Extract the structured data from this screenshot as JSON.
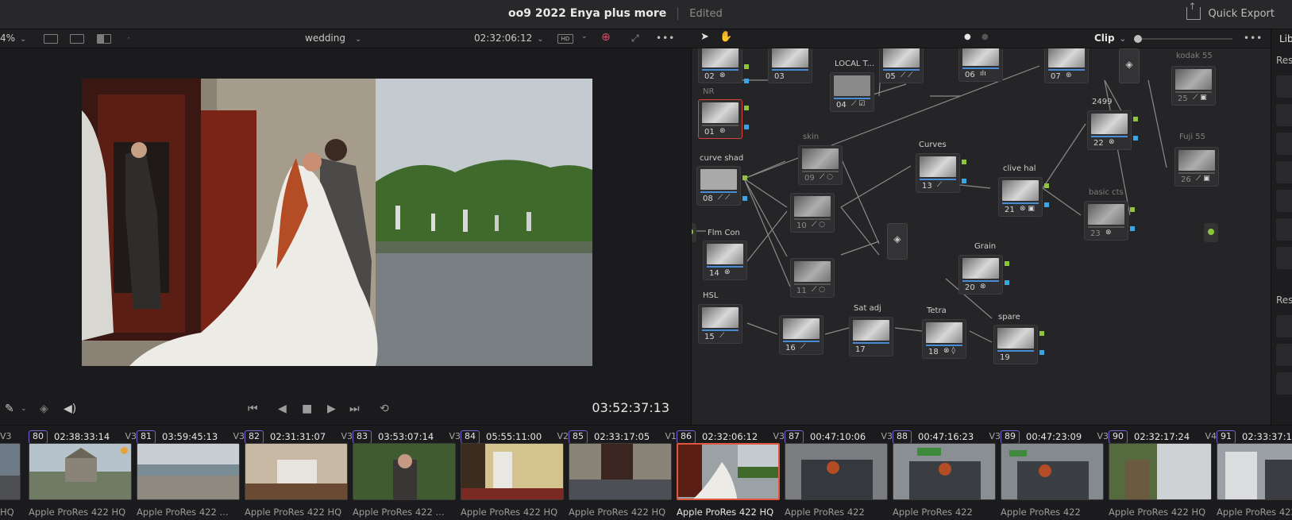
{
  "title_bar": {
    "project": "oo9 2022  Enya plus more",
    "status": "Edited",
    "quick_export": "Quick Export"
  },
  "viewer_toolbar": {
    "zoom": "4%",
    "timeline": "wedding",
    "timecode": "02:32:06:12"
  },
  "transport": {
    "timecode": "03:52:37:13"
  },
  "node_toolbar": {
    "mode": "Clip"
  },
  "library_panel": {
    "tab": "Lib",
    "section1": "Res",
    "section2": "Res"
  },
  "nodes": [
    {
      "id": "01",
      "label": "NR",
      "icons": "⊛"
    },
    {
      "id": "02",
      "label": "",
      "icons": "⊗"
    },
    {
      "id": "03",
      "label": "",
      "icons": ""
    },
    {
      "id": "04",
      "label": "LOCAL T...",
      "icons": "⟋ ☑"
    },
    {
      "id": "05",
      "label": "",
      "icons": "⟋ ⟋"
    },
    {
      "id": "06",
      "label": "",
      "icons": "ıIı"
    },
    {
      "id": "07",
      "label": "",
      "icons": "⊛"
    },
    {
      "id": "08",
      "label": "curve shad",
      "icons": "⟋ ⟋"
    },
    {
      "id": "09",
      "label": "skin",
      "icons": "⟋ ◌"
    },
    {
      "id": "10",
      "label": "",
      "icons": "⟋ ◌"
    },
    {
      "id": "11",
      "label": "",
      "icons": "⟋ ◌"
    },
    {
      "id": "13",
      "label": "Curves",
      "icons": "⟋"
    },
    {
      "id": "14",
      "label": "Flm Con",
      "icons": "⊗"
    },
    {
      "id": "15",
      "label": "HSL",
      "icons": "⟋"
    },
    {
      "id": "16",
      "label": "",
      "icons": "⟋"
    },
    {
      "id": "17",
      "label": "Sat adj",
      "icons": ""
    },
    {
      "id": "18",
      "label": "Tetra",
      "icons": "⊗ ◊"
    },
    {
      "id": "19",
      "label": "spare",
      "icons": ""
    },
    {
      "id": "20",
      "label": "Grain",
      "icons": "⊗"
    },
    {
      "id": "21",
      "label": "clive hal",
      "icons": "⊗ ▣"
    },
    {
      "id": "22",
      "label": "2499",
      "icons": "⊗"
    },
    {
      "id": "23",
      "label": "basic cts",
      "icons": "⊗"
    },
    {
      "id": "25",
      "label": "kodak 55",
      "icons": "⟋ ▣"
    },
    {
      "id": "26",
      "label": "Fuji 55",
      "icons": "⟋ ▣"
    }
  ],
  "clips": [
    {
      "num": "80",
      "tc": "02:38:33:14",
      "track": "V3",
      "codec": "Apple ProRes 422 HQ"
    },
    {
      "num": "81",
      "tc": "03:59:45:13",
      "track": "V3",
      "codec": "Apple ProRes 422 ..."
    },
    {
      "num": "82",
      "tc": "02:31:31:07",
      "track": "V3",
      "codec": "Apple ProRes 422 HQ"
    },
    {
      "num": "83",
      "tc": "03:53:07:14",
      "track": "V3",
      "codec": "Apple ProRes 422 ..."
    },
    {
      "num": "84",
      "tc": "05:55:11:00",
      "track": "V2",
      "codec": "Apple ProRes 422 HQ"
    },
    {
      "num": "85",
      "tc": "02:33:17:05",
      "track": "V1",
      "codec": "Apple ProRes 422 HQ"
    },
    {
      "num": "86",
      "tc": "02:32:06:12",
      "track": "V3",
      "codec": "Apple ProRes 422 HQ"
    },
    {
      "num": "87",
      "tc": "00:47:10:06",
      "track": "V3",
      "codec": "Apple ProRes 422"
    },
    {
      "num": "88",
      "tc": "00:47:16:23",
      "track": "V3",
      "codec": "Apple ProRes 422"
    },
    {
      "num": "89",
      "tc": "00:47:23:09",
      "track": "V3",
      "codec": "Apple ProRes 422"
    },
    {
      "num": "90",
      "tc": "02:32:17:24",
      "track": "V4",
      "codec": "Apple ProRes 422 HQ"
    },
    {
      "num": "91",
      "tc": "02:33:37:12",
      "track": "",
      "codec": "Apple ProRes 422"
    }
  ],
  "partial_clip": {
    "track": "V3",
    "codec": "HQ"
  },
  "colors": {
    "accent_blue": "#3aa6e6",
    "node_input_green": "#8dc53d",
    "selected_red": "#e0563e"
  }
}
